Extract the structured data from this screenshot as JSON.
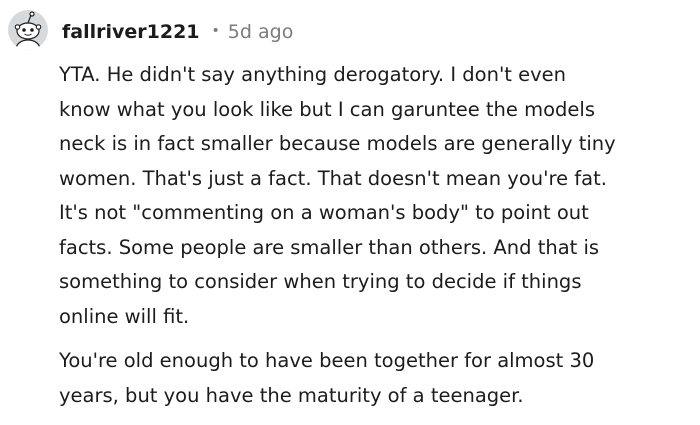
{
  "comment": {
    "avatar": "snoo-avatar-icon",
    "username": "fallriver1221",
    "separator": "•",
    "age": "5d ago",
    "paragraphs": [
      "YTA. He didn't say anything derogatory. I don't even\nknow what you look like but I can garuntee the models\nneck is in fact smaller because models are generally tiny\nwomen. That's just a fact. That doesn't mean you're fat.\nIt's not \"commenting on a woman's body\" to point out\nfacts. Some people are smaller than others. And that is\nsomething to consider when trying to decide if things\nonline will fit.",
      "You're old enough to have been together for almost 30\nyears, but you have the maturity of a teenager."
    ]
  },
  "colors": {
    "text": "#1c1c1c",
    "meta": "#7c7c7c",
    "avatar_bg": "#d7dadc",
    "avatar_face": "#ffffff"
  }
}
